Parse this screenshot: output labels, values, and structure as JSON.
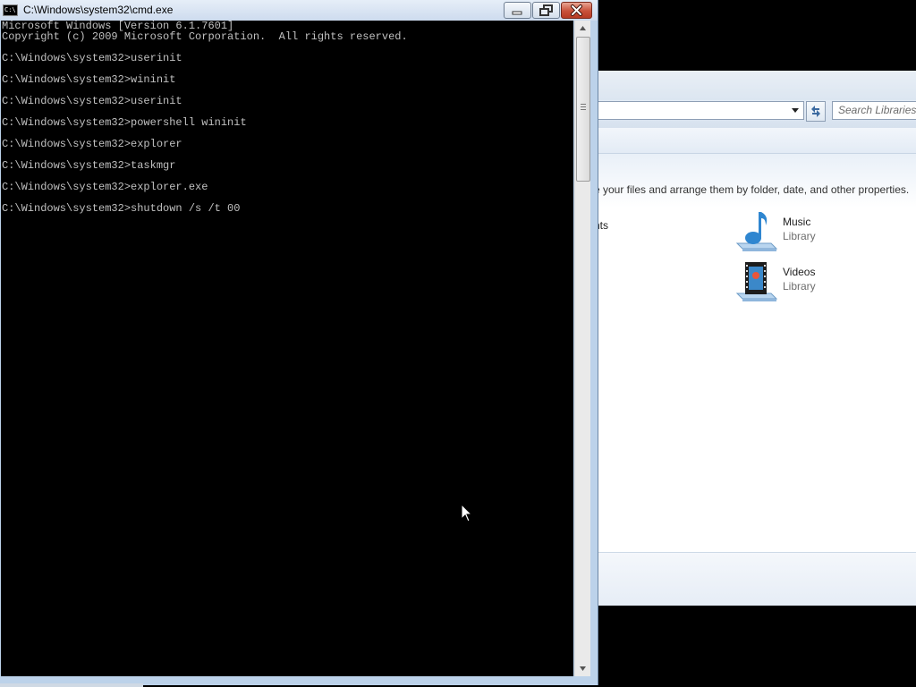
{
  "explorer": {
    "search_placeholder": "Search Libraries",
    "description": "e your files and arrange them by folder, date, and other properties.",
    "partial_item_label": "nts",
    "libraries": [
      {
        "name": "Music",
        "type": "Library",
        "icon": "music-library-icon"
      },
      {
        "name": "Videos",
        "type": "Library",
        "icon": "videos-library-icon"
      }
    ]
  },
  "cmd": {
    "title": "C:\\Windows\\system32\\cmd.exe",
    "icon_text": "C:\\",
    "lines": [
      "Microsoft Windows [Version 6.1.7601]",
      "Copyright (c) 2009 Microsoft Corporation.  All rights reserved.",
      "",
      "C:\\Windows\\system32>userinit",
      "",
      "C:\\Windows\\system32>wininit",
      "",
      "C:\\Windows\\system32>userinit",
      "",
      "C:\\Windows\\system32>powershell wininit",
      "",
      "C:\\Windows\\system32>explorer",
      "",
      "C:\\Windows\\system32>taskmgr",
      "",
      "C:\\Windows\\system32>explorer.exe",
      "",
      "C:\\Windows\\system32>shutdown /s /t 00"
    ]
  }
}
